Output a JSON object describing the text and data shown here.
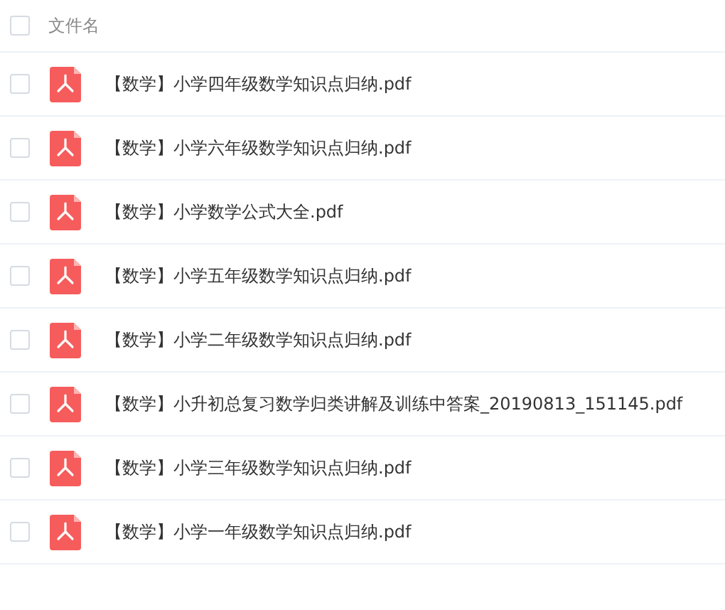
{
  "header": {
    "label": "文件名",
    "checked": false
  },
  "files": [
    {
      "name": "【数学】小学四年级数学知识点归纳.pdf",
      "checked": false
    },
    {
      "name": "【数学】小学六年级数学知识点归纳.pdf",
      "checked": false
    },
    {
      "name": "【数学】小学数学公式大全.pdf",
      "checked": false
    },
    {
      "name": "【数学】小学五年级数学知识点归纳.pdf",
      "checked": false
    },
    {
      "name": "【数学】小学二年级数学知识点归纳.pdf",
      "checked": false
    },
    {
      "name": "【数学】小升初总复习数学归类讲解及训练中答案_20190813_151145.pdf",
      "checked": false
    },
    {
      "name": "【数学】小学三年级数学知识点归纳.pdf",
      "checked": false
    },
    {
      "name": "【数学】小学一年级数学知识点归纳.pdf",
      "checked": false
    }
  ]
}
